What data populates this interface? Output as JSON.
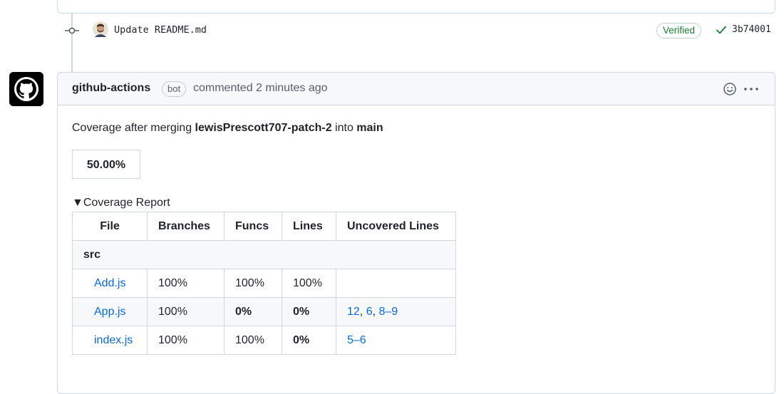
{
  "commit": {
    "message": "Update README.md",
    "verified_label": "Verified",
    "sha": "3b74001"
  },
  "comment": {
    "author": "github-actions",
    "badge": "bot",
    "action": "commented 2 minutes ago",
    "body_prefix": "Coverage after merging ",
    "branch": "lewisPrescott707-patch-2",
    "body_mid": " into ",
    "target": "main",
    "coverage_pct": "50.00%",
    "summary_label": "▼Coverage Report"
  },
  "table": {
    "headers": [
      "File",
      "Branches",
      "Funcs",
      "Lines",
      "Uncovered Lines"
    ],
    "group": "src",
    "rows": [
      {
        "file": "Add.js",
        "branches": "100%",
        "funcs": "100%",
        "lines": "100%",
        "uncovered": []
      },
      {
        "file": "App.js",
        "branches": "100%",
        "funcs": "0%",
        "lines": "0%",
        "uncovered": [
          "12",
          "6",
          "8–9"
        ]
      },
      {
        "file": "index.js",
        "branches": "100%",
        "funcs": "100%",
        "lines": "0%",
        "uncovered": [
          "5–6"
        ]
      }
    ]
  },
  "colors": {
    "link": "#0969da",
    "verified": "#1a7f37",
    "border": "#d0d7de"
  },
  "icons": [
    "commit-node-icon",
    "user-avatar",
    "check-icon",
    "github-logo-icon",
    "smiley-icon",
    "kebab-menu-icon"
  ]
}
